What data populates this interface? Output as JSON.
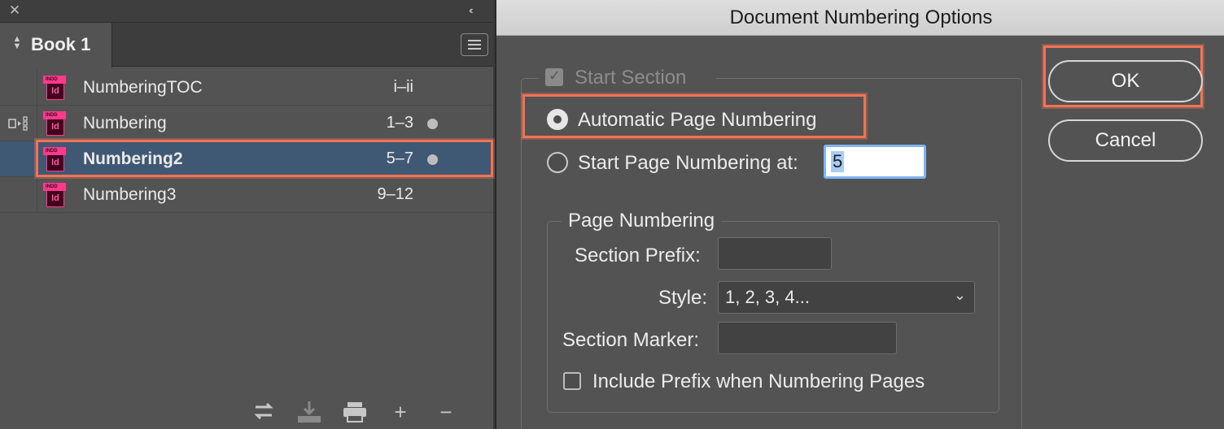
{
  "book_panel": {
    "tab_label": "Book 1",
    "documents": [
      {
        "name": "NumberingTOC",
        "pages": "i–ii",
        "icon": "indd-file-icon",
        "status_dot": false,
        "sync_source": false,
        "selected": false
      },
      {
        "name": "Numbering",
        "pages": "1–3",
        "icon": "indd-file-icon",
        "status_dot": true,
        "sync_source": true,
        "selected": false
      },
      {
        "name": "Numbering2",
        "pages": "5–7",
        "icon": "indd-file-icon",
        "status_dot": true,
        "sync_source": false,
        "selected": true
      },
      {
        "name": "Numbering3",
        "pages": "9–12",
        "icon": "indd-file-icon",
        "status_dot": false,
        "sync_source": false,
        "selected": false
      }
    ],
    "file_icon_text": {
      "top": "INDD",
      "badge": "Id"
    },
    "footer_icons": [
      "synchronize-icon",
      "add-document-icon",
      "print-icon",
      "plus-icon",
      "minus-icon"
    ]
  },
  "dialog": {
    "title": "Document Numbering Options",
    "start_section": {
      "label": "Start Section",
      "checked": true,
      "disabled": true
    },
    "automatic_page_numbering": {
      "label": "Automatic Page Numbering",
      "selected": true
    },
    "start_page_numbering": {
      "label": "Start Page Numbering at:",
      "selected": false,
      "value": "5"
    },
    "page_numbering_group": {
      "legend": "Page Numbering",
      "section_prefix_label": "Section Prefix:",
      "section_prefix_value": "",
      "style_label": "Style:",
      "style_value": "1, 2, 3, 4...",
      "section_marker_label": "Section Marker:",
      "section_marker_value": "",
      "include_prefix_label": "Include Prefix when Numbering Pages",
      "include_prefix_checked": false
    },
    "ok_label": "OK",
    "cancel_label": "Cancel"
  },
  "colors": {
    "panel_bg": "#535353",
    "selection_bg": "#3f5873",
    "highlight_annotation": "#f07355",
    "indd_pink": "#ff3a8c"
  }
}
